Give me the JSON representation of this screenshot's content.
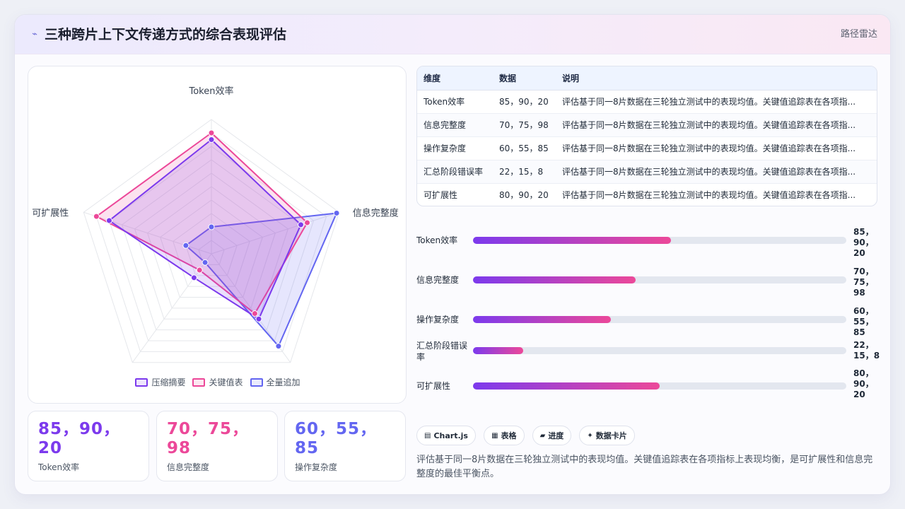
{
  "header": {
    "icon": "spark-icon",
    "title": "三种跨片上下文传递方式的综合表现评估",
    "right_label": "路径雷达"
  },
  "chart_data": {
    "type": "radar",
    "axes": [
      "Token效率",
      "信息完整度",
      "操作复杂度",
      "汇总阶段错误率",
      "可扩展性"
    ],
    "range": [
      0,
      100
    ],
    "series": [
      {
        "name": "压缩摘要",
        "values": [
          85,
          70,
          60,
          22,
          80
        ],
        "color": "#7c3aed"
      },
      {
        "name": "关键值表",
        "values": [
          90,
          75,
          55,
          15,
          90
        ],
        "color": "#ec4899"
      },
      {
        "name": "全量追加",
        "values": [
          20,
          98,
          85,
          8,
          20
        ],
        "color": "#6366f1"
      }
    ],
    "legend_position": "bottom"
  },
  "stats": [
    {
      "value": "85，90，20",
      "label": "Token效率",
      "color": "#7c3aed"
    },
    {
      "value": "70，75，98",
      "label": "信息完整度",
      "color": "#ec4899"
    },
    {
      "value": "60，55，85",
      "label": "操作复杂度",
      "color": "#6366f1"
    }
  ],
  "table": {
    "headers": [
      "维度",
      "数据",
      "说明"
    ],
    "rows": [
      [
        "Token效率",
        "85，90，20",
        "评估基于同一8片数据在三轮独立测试中的表现均值。关键值追踪表在各项指..."
      ],
      [
        "信息完整度",
        "70，75，98",
        "评估基于同一8片数据在三轮独立测试中的表现均值。关键值追踪表在各项指..."
      ],
      [
        "操作复杂度",
        "60，55，85",
        "评估基于同一8片数据在三轮独立测试中的表现均值。关键值追踪表在各项指..."
      ],
      [
        "汇总阶段错误率",
        "22，15，8",
        "评估基于同一8片数据在三轮独立测试中的表现均值。关键值追踪表在各项指..."
      ],
      [
        "可扩展性",
        "80，90，20",
        "评估基于同一8片数据在三轮独立测试中的表现均值。关键值追踪表在各项指..."
      ]
    ]
  },
  "progress": [
    {
      "label": "Token效率",
      "value": "85，90，20",
      "fill": 0.53
    },
    {
      "label": "信息完整度",
      "value": "70，75，98",
      "fill": 0.435
    },
    {
      "label": "操作复杂度",
      "value": "60，55，85",
      "fill": 0.37
    },
    {
      "label": "汇总阶段错误率",
      "value": "22，15，8",
      "fill": 0.135
    },
    {
      "label": "可扩展性",
      "value": "80，90，20",
      "fill": 0.5
    }
  ],
  "tags": [
    {
      "icon": "chart-icon",
      "glyph": "▤",
      "label": "Chart.js"
    },
    {
      "icon": "table-icon",
      "glyph": "▦",
      "label": "表格"
    },
    {
      "icon": "progress-icon",
      "glyph": "▰",
      "label": "进度"
    },
    {
      "icon": "card-icon",
      "glyph": "✦",
      "label": "数据卡片"
    }
  ],
  "note": "评估基于同一8片数据在三轮独立测试中的表现均值。关键值追踪表在各项指标上表现均衡，是可扩展性和信息完整度的最佳平衡点。"
}
